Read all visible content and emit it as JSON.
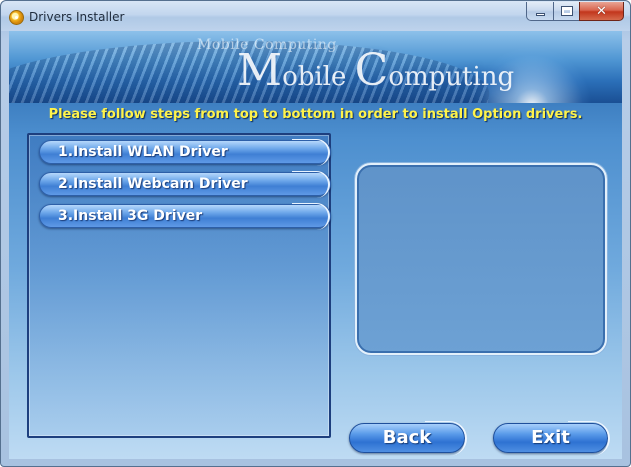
{
  "window": {
    "title": "Drivers Installer",
    "icon": "installer-disc-icon",
    "controls": {
      "minimize": "minimize-icon",
      "maximize": "maximize-icon",
      "close": "close-icon"
    }
  },
  "banner": {
    "small_text": "Mobile Computing",
    "big_M": "M",
    "big_obile": "obile ",
    "big_C": "C",
    "big_omputing": "omputing"
  },
  "instruction": "Please follow steps from top to bottom in order to install Option drivers.",
  "drivers": [
    {
      "label": "1.Install WLAN Driver"
    },
    {
      "label": "2.Install Webcam Driver"
    },
    {
      "label": "3.Install 3G Driver"
    }
  ],
  "buttons": {
    "back": "Back",
    "exit": "Exit"
  },
  "colors": {
    "instruction_text": "#fff34a",
    "client_top": "#1f5fa6",
    "button_blue": "#3f7fd4"
  }
}
